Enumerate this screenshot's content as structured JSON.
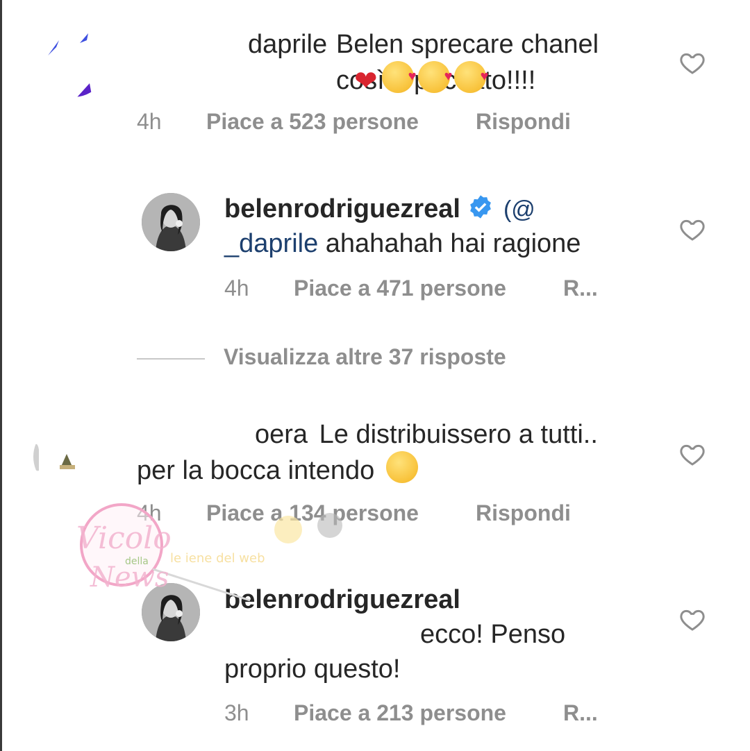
{
  "comments": [
    {
      "username_visible": "daprile",
      "text": "Belen sprecare chanel così è peccato!!!!",
      "emoji": [
        "red-heart",
        "kissing-face",
        "kissing-face",
        "kissing-face"
      ],
      "time": "4h",
      "likes": "Piace a 523 persone",
      "reply": "Rispondi",
      "replies": [
        {
          "username": "belenrodriguezreal",
          "verified": true,
          "mention": "(@... _daprile",
          "text": "ahahahah hai ragione",
          "time": "4h",
          "likes": "Piace a 471 persone",
          "reply": "R..."
        }
      ],
      "view_more": "Visualizza altre 37 risposte"
    },
    {
      "username_visible": "oera",
      "text_line1": "Le distribuissero a tutti..",
      "text_line2": "per la bocca intendo",
      "emoji": [
        "winking-face"
      ],
      "time": "4h",
      "likes": "Piace a 134 persone",
      "reply": "Rispondi",
      "replies": [
        {
          "username": "belenrodriguezreal",
          "text_line1": "ecco! Penso",
          "text_line2": "proprio questo!",
          "time": "3h",
          "likes": "Piace a 213 persone",
          "reply": "R..."
        }
      ]
    }
  ],
  "watermark": {
    "logo_text": "Vicolo della News",
    "banner_text": "le iene del web"
  },
  "colors": {
    "text": "#262626",
    "meta": "#8e8e8e",
    "verified": "#3897f0",
    "emoji_heart": "#d9242f"
  }
}
